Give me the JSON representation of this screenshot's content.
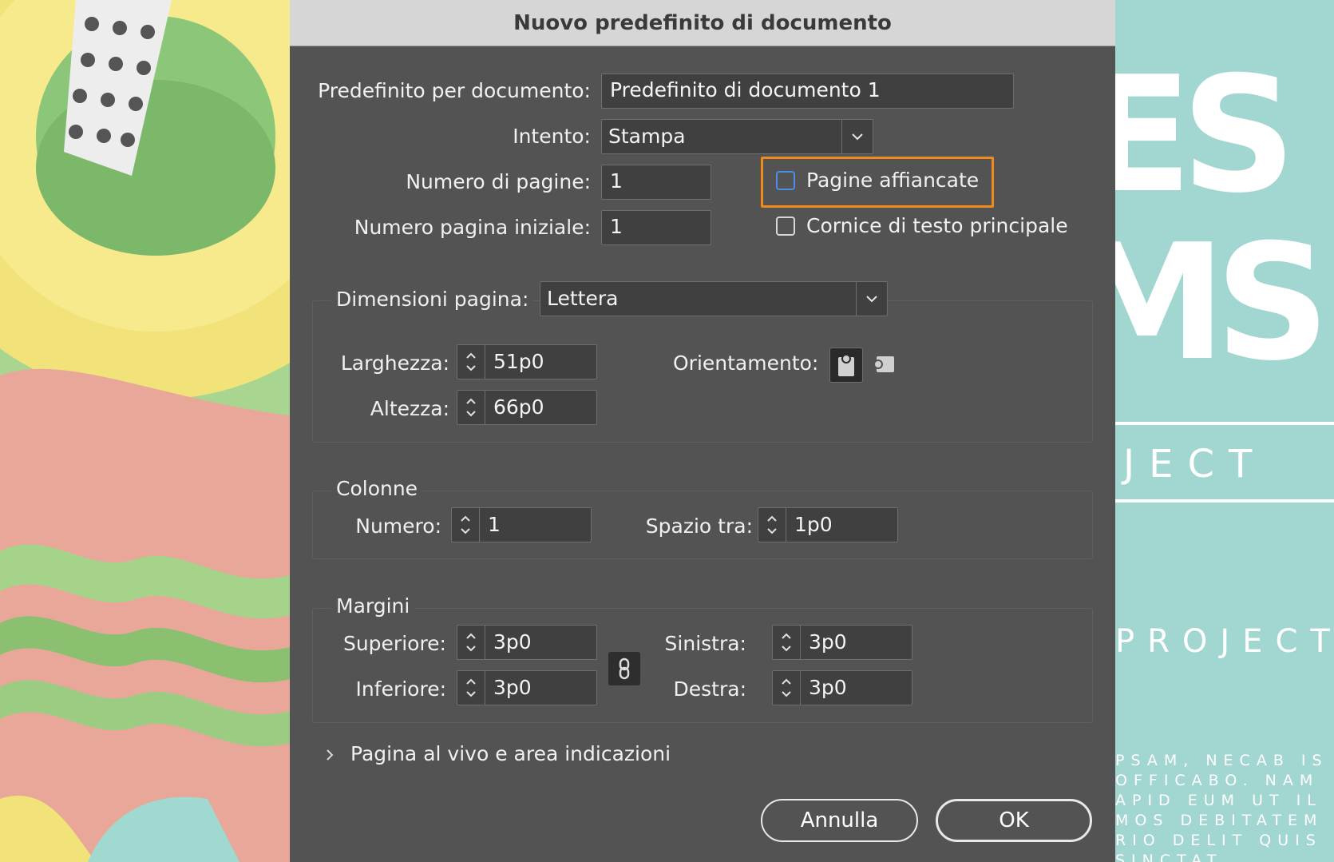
{
  "dialog": {
    "title": "Nuovo predefinito di documento",
    "preset": {
      "label": "Predefinito per documento:",
      "value": "Predefinito di documento 1"
    },
    "intent": {
      "label": "Intento:",
      "value": "Stampa"
    },
    "num_pages": {
      "label": "Numero di pagine:",
      "value": "1"
    },
    "start_page": {
      "label": "Numero pagina iniziale:",
      "value": "1"
    },
    "facing_pages": {
      "label": "Pagine affiancate",
      "checked": false
    },
    "primary_text_frame": {
      "label": "Cornice di testo principale",
      "checked": false
    },
    "page_size": {
      "label": "Dimensioni pagina:",
      "value": "Lettera",
      "width": {
        "label": "Larghezza:",
        "value": "51p0"
      },
      "height": {
        "label": "Altezza:",
        "value": "66p0"
      },
      "orientation": {
        "label": "Orientamento:",
        "selected": "portrait"
      }
    },
    "columns": {
      "title": "Colonne",
      "number": {
        "label": "Numero:",
        "value": "1"
      },
      "gutter": {
        "label": "Spazio tra:",
        "value": "1p0"
      }
    },
    "margins": {
      "title": "Margini",
      "top": {
        "label": "Superiore:",
        "value": "3p0"
      },
      "bottom": {
        "label": "Inferiore:",
        "value": "3p0"
      },
      "left": {
        "label": "Sinistra:",
        "value": "3p0"
      },
      "right": {
        "label": "Destra:",
        "value": "3p0"
      }
    },
    "bleed_section": {
      "label": "Pagina al vivo e area indicazioni"
    },
    "buttons": {
      "cancel": "Annulla",
      "ok": "OK"
    }
  },
  "background_right": {
    "big_line1": "ES",
    "big_line2": "MS",
    "subtitle": "JECT",
    "subtitle2": "PROJECT",
    "body_lines": [
      "PSAM, NECAB IS",
      "OFFICABO. NAM",
      "APID EUM UT IL",
      "MOS DEBITATEM",
      "RIO DELIT QUIS",
      "SINCTAT"
    ]
  },
  "colors": {
    "dialog_bg": "#535353",
    "highlight": "#f08a1c",
    "focus": "#4a8ee8"
  }
}
